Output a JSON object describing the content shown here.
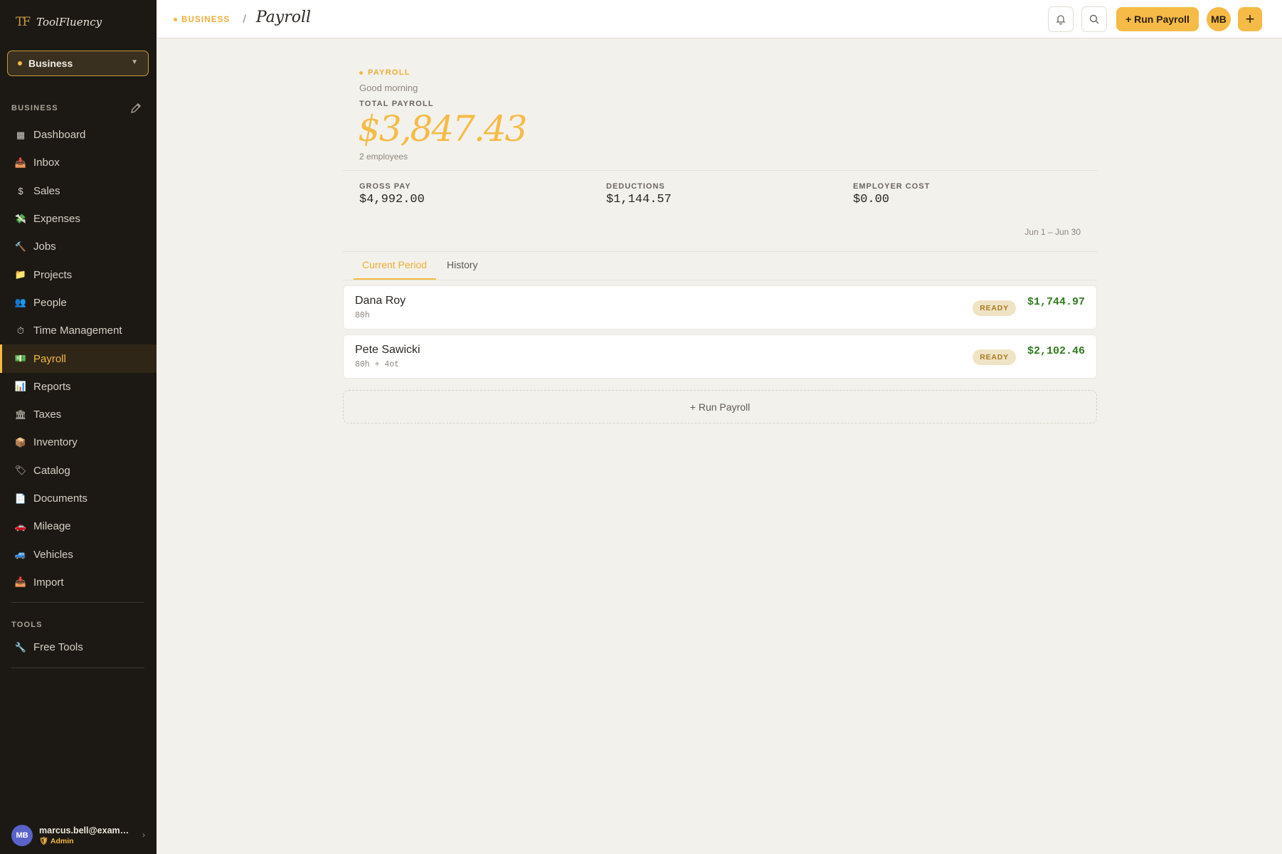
{
  "brand": {
    "mark": "TF",
    "name": "ToolFluency"
  },
  "workspace": {
    "label": "Business"
  },
  "sidebar": {
    "section_business": "BUSINESS",
    "section_tools": "TOOLS",
    "items": [
      {
        "label": "Dashboard",
        "icon": "dashboard-icon",
        "glyph": "▦"
      },
      {
        "label": "Inbox",
        "icon": "inbox-icon",
        "glyph": "📥"
      },
      {
        "label": "Sales",
        "icon": "dollar-icon",
        "glyph": "$"
      },
      {
        "label": "Expenses",
        "icon": "money-wings-icon",
        "glyph": "💸"
      },
      {
        "label": "Jobs",
        "icon": "hammer-icon",
        "glyph": "🔨"
      },
      {
        "label": "Projects",
        "icon": "folder-icon",
        "glyph": "📁"
      },
      {
        "label": "People",
        "icon": "people-icon",
        "glyph": "👥"
      },
      {
        "label": "Time Management",
        "icon": "stopwatch-icon",
        "glyph": "⏱"
      },
      {
        "label": "Payroll",
        "icon": "banknote-icon",
        "glyph": "💵"
      },
      {
        "label": "Reports",
        "icon": "bar-chart-icon",
        "glyph": "📊"
      },
      {
        "label": "Taxes",
        "icon": "bank-icon",
        "glyph": "🏛"
      },
      {
        "label": "Inventory",
        "icon": "package-icon",
        "glyph": "📦"
      },
      {
        "label": "Catalog",
        "icon": "tag-icon",
        "glyph": "🏷"
      },
      {
        "label": "Documents",
        "icon": "document-icon",
        "glyph": "📄"
      },
      {
        "label": "Mileage",
        "icon": "car-icon",
        "glyph": "🚗"
      },
      {
        "label": "Vehicles",
        "icon": "truck-icon",
        "glyph": "🚙"
      },
      {
        "label": "Import",
        "icon": "import-icon",
        "glyph": "📥"
      }
    ],
    "tools": [
      {
        "label": "Free Tools",
        "icon": "wrench-icon",
        "glyph": "🔧"
      }
    ],
    "active": "Payroll"
  },
  "user": {
    "initials": "MB",
    "email": "marcus.bell@example...",
    "role": "Admin"
  },
  "topbar": {
    "crumb_section": "BUSINESS",
    "crumb_sep": "/",
    "page_title": "Payroll",
    "run_payroll_label": "+ Run Payroll",
    "avatar_initials": "MB",
    "plus_label": "+"
  },
  "summary": {
    "eyebrow": "PAYROLL",
    "greeting": "Good morning",
    "total_label": "TOTAL PAYROLL",
    "total_value": "$3,847.43",
    "employee_count": "2 employees",
    "stats": [
      {
        "label": "GROSS PAY",
        "value": "$4,992.00"
      },
      {
        "label": "DEDUCTIONS",
        "value": "$1,144.57"
      },
      {
        "label": "EMPLOYER COST",
        "value": "$0.00"
      }
    ],
    "period": "Jun 1 – Jun 30"
  },
  "tabs": [
    {
      "label": "Current Period",
      "active": true
    },
    {
      "label": "History",
      "active": false
    }
  ],
  "employees": [
    {
      "name": "Dana Roy",
      "hours": "80h",
      "status": "READY",
      "amount": "$1,744.97"
    },
    {
      "name": "Pete Sawicki",
      "hours": "80h + 4ot",
      "status": "READY",
      "amount": "$2,102.46"
    }
  ],
  "run_payroll_dashed": "+ Run Payroll",
  "colors": {
    "accent": "#f6bb46",
    "sidebar_bg": "#1c1915",
    "amount_green": "#2f7a1f"
  }
}
